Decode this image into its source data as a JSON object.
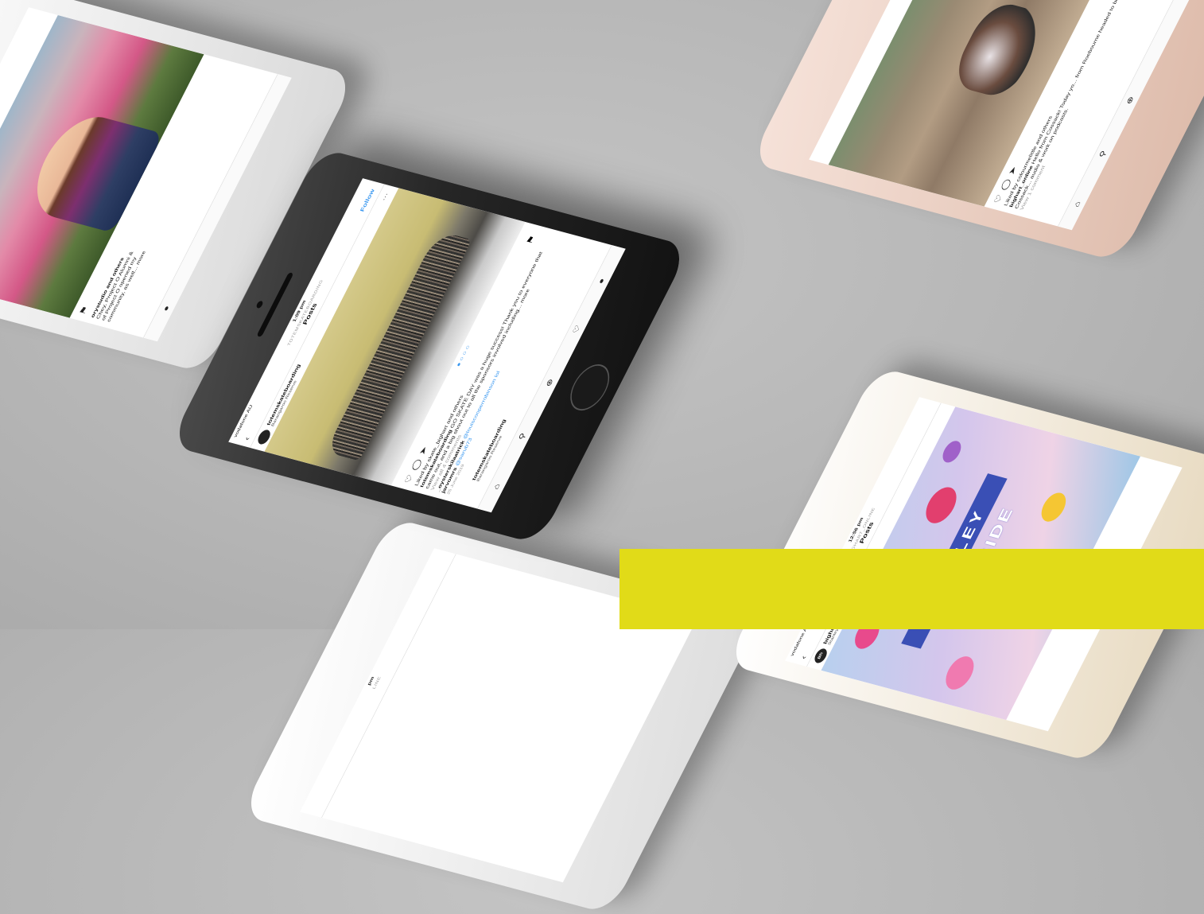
{
  "colors": {
    "background": "#b8b8b8",
    "accent_yellow": "#e1db18",
    "instagram_blue": "#3897f0"
  },
  "center_phone": {
    "carrier": "vodafone AU",
    "time": "1:09 pm",
    "header_sub": "TOTEMSKATEBOARDING",
    "header_title": "Posts",
    "follow_label": "Follow",
    "account_name": "totemskateboarding",
    "account_location": "Barangaroo Reserve",
    "liked_by": "Liked by skate_bighart and others",
    "caption_user": "totemskateboarding",
    "caption_text": "GO SKATE DAY was a huge success! Thank you to everyone that came out, and a big shout out to all the sponsors involved including... more",
    "view_comments": "View all 4 comments",
    "comment1_user": "_oysterskilaatrick",
    "comment1_text": "@louiscooperrobinson lol",
    "comment2_user": "jarvomrs",
    "comment2_text": "@sarub73",
    "date": "25 June 2019",
    "next_account_name": "totemskateboarding",
    "next_account_location": "Barangaroo Reserve"
  },
  "top_left_phone": {
    "liked_by": "orystudio and others",
    "caption_line1": "Chey, Project O Alumni &",
    "caption_line2": "of Project O opened my",
    "caption_line3": "community, as well... more"
  },
  "top_right_phone": {
    "liked_by": "Liked by colourmelittle and others",
    "caption_user": "bighart_online",
    "caption_text": "Hello from Cossack! Today yo... from Roebourne headed to beautiful Cossack... audio & work on podcasts.",
    "view_comments": "View 1 comment"
  },
  "bottom_right_phone": {
    "carrier": "vodafone AU",
    "time": "12:56 pm",
    "header_sub": "BIGHART_ONLINE",
    "header_title": "Posts",
    "avatar_text": "Bh",
    "account_name": "bighart_online",
    "account_location": "Stanley, Tasmania",
    "poster_line1": "STANLEY",
    "poster_line2": "DOCKSIDE"
  },
  "bottom_center_phone": {
    "time": "pm",
    "header_sub": "LINE"
  },
  "icons": [
    "heart-icon",
    "comment-icon",
    "share-icon",
    "bookmark-icon",
    "home-icon",
    "search-icon",
    "add-icon",
    "back-icon",
    "more-icon"
  ]
}
